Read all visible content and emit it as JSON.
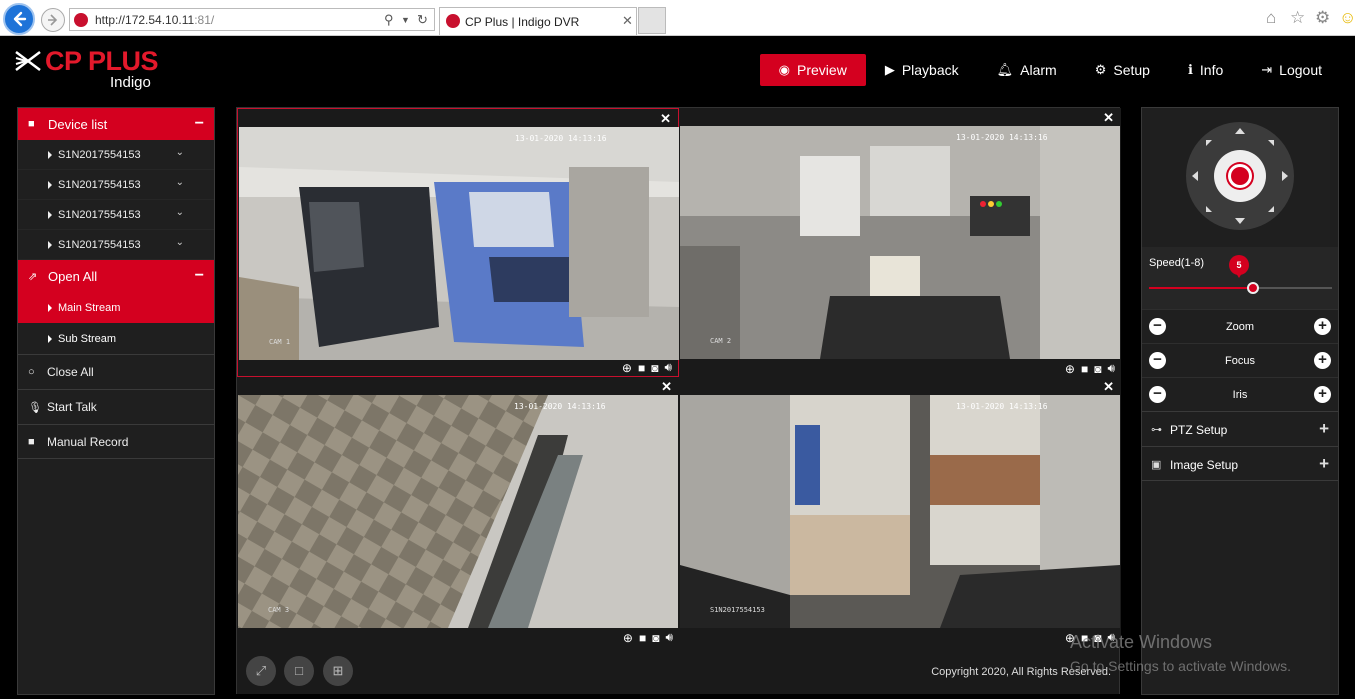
{
  "browser": {
    "url_prefix": "http://172.54.10.11",
    "url_suffix": ":81/",
    "tab_title": "CP Plus | Indigo DVR"
  },
  "app": {
    "brand": "CP PLUS",
    "product": "Indigo",
    "nav": [
      "Preview",
      "Playback",
      "Alarm",
      "Setup",
      "Info",
      "Logout"
    ],
    "active_nav": "Preview"
  },
  "left_panel": {
    "device_list_label": "Device list",
    "devices": [
      "S1N2017554153",
      "S1N2017554153",
      "S1N2017554153",
      "S1N2017554153"
    ],
    "open_all_label": "Open All",
    "streams": [
      "Main Stream",
      "Sub Stream"
    ],
    "active_stream": "Main Stream",
    "close_all_label": "Close All",
    "start_talk_label": "Start Talk",
    "manual_record_label": "Manual Record"
  },
  "cameras": [
    {
      "timestamp": "13-01-2020 14:13:16",
      "name": "CAM 1"
    },
    {
      "timestamp": "13-01-2020 14:13:16",
      "name": "CAM 2"
    },
    {
      "timestamp": "13-01-2020 14:13:16",
      "name": "CAM 3"
    },
    {
      "timestamp": "13-01-2020 14:13:16",
      "name": "S1N2017554153"
    }
  ],
  "footer": {
    "copyright": "Copyright 2020, All Rights Reserved."
  },
  "ptz": {
    "speed_label": "Speed(1-8)",
    "speed_value": 5,
    "speed_fraction": 0.57,
    "controls": [
      "Zoom",
      "Focus",
      "Iris"
    ],
    "ptz_setup_label": "PTZ Setup",
    "image_setup_label": "Image Setup"
  },
  "watermark": {
    "line1": "Activate Windows",
    "line2": "Go to Settings to activate Windows."
  },
  "colors": {
    "accent": "#d4001f",
    "panel": "#1f1f1f",
    "background": "#000000"
  }
}
